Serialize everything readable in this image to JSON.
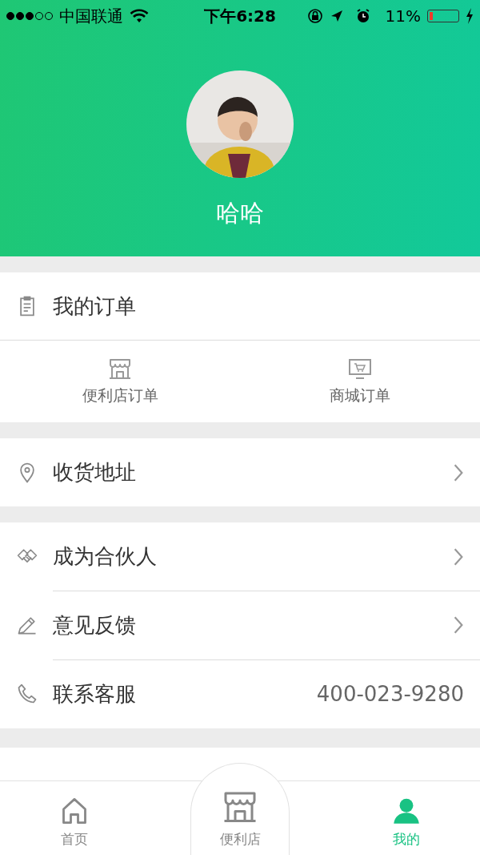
{
  "status_bar": {
    "carrier": "中国联通",
    "time": "下午6:28",
    "battery": "11%"
  },
  "profile": {
    "name": "哈哈"
  },
  "orders": {
    "title": "我的订单",
    "links": [
      {
        "label": "便利店订单"
      },
      {
        "label": "商城订单"
      }
    ]
  },
  "menu_groups": [
    {
      "items": [
        {
          "label": "收货地址",
          "kind": "link"
        }
      ]
    },
    {
      "items": [
        {
          "label": "成为合伙人",
          "kind": "link"
        },
        {
          "label": "意见反馈",
          "kind": "link"
        },
        {
          "label": "联系客服",
          "kind": "value",
          "value": "400-023-9280"
        }
      ]
    }
  ],
  "tab_bar": [
    {
      "label": "首页",
      "selected": false,
      "kind": "plain"
    },
    {
      "label": "便利店",
      "selected": false,
      "kind": "raised"
    },
    {
      "label": "我的",
      "selected": true,
      "kind": "plain"
    }
  ]
}
